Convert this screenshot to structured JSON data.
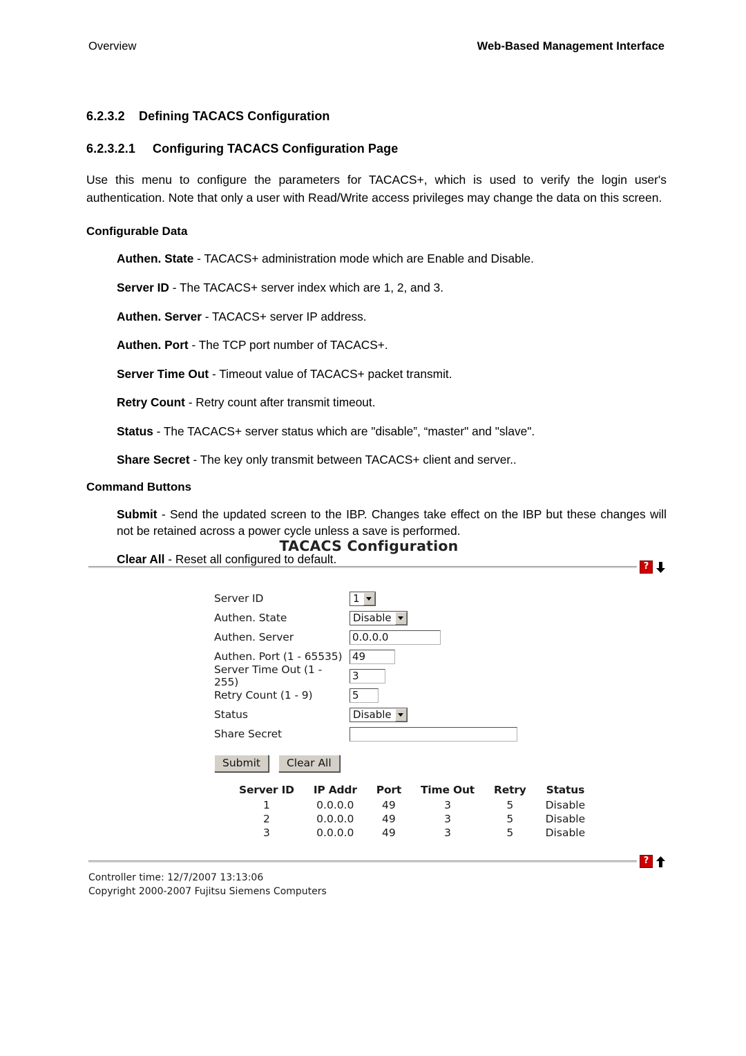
{
  "running_head": {
    "left": "Overview",
    "right": "Web-Based Management Interface"
  },
  "document": {
    "section": {
      "number": "6.2.3.2",
      "title": "Defining TACACS Configuration"
    },
    "subsection": {
      "number": "6.2.3.2.1",
      "title": "Configuring TACACS Configuration Page"
    },
    "intro": "Use this menu to configure the parameters for TACACS+, which is used to verify the login user's authentication. Note that only a user with Read/Write access privileges may change the data on this screen.",
    "configurable_data": {
      "heading": "Configurable Data",
      "items": [
        {
          "term": "Authen. State",
          "desc": " - TACACS+ administration mode which are Enable and Disable."
        },
        {
          "term": "Server ID",
          "desc": " - The TACACS+ server index which are 1, 2, and 3."
        },
        {
          "term": "Authen. Server",
          "desc": " - TACACS+ server IP address."
        },
        {
          "term": "Authen. Port",
          "desc": " - The TCP port number of TACACS+."
        },
        {
          "term": "Server Time Out",
          "desc": " - Timeout value of TACACS+ packet transmit."
        },
        {
          "term": "Retry Count",
          "desc": " - Retry count after transmit timeout."
        },
        {
          "term": "Status",
          "desc": " - The TACACS+ server status which are \"disable”, “master\" and \"slave\"."
        },
        {
          "term": "Share Secret",
          "desc": " - The key only transmit between TACACS+ client and server.."
        }
      ]
    },
    "command_buttons": {
      "heading": "Command Buttons",
      "items": [
        {
          "term": "Submit",
          "desc": " - Send the updated screen to the IBP. Changes take effect on the IBP but these changes will not be retained across a power cycle unless a save is performed."
        },
        {
          "term": "Clear All",
          "desc": " - Reset all configured to default."
        }
      ]
    }
  },
  "screenshot": {
    "title": "TACACS Configuration",
    "help_icon_label": "?",
    "form": {
      "server_id": {
        "label": "Server ID",
        "value": "1",
        "control": "select"
      },
      "authen_state": {
        "label": "Authen. State",
        "value": "Disable",
        "control": "select"
      },
      "authen_server": {
        "label": "Authen. Server",
        "value": "0.0.0.0",
        "control": "text"
      },
      "authen_port": {
        "label": "Authen. Port (1 - 65535)",
        "value": "49",
        "control": "text"
      },
      "server_time_out": {
        "label": "Server Time Out (1 - 255)",
        "value": "3",
        "control": "text"
      },
      "retry_count": {
        "label": "Retry Count (1 - 9)",
        "value": "5",
        "control": "text"
      },
      "status": {
        "label": "Status",
        "value": "Disable",
        "control": "select"
      },
      "share_secret": {
        "label": "Share Secret",
        "value": "",
        "control": "text"
      }
    },
    "buttons": {
      "submit": "Submit",
      "clear_all": "Clear All"
    },
    "table": {
      "columns": [
        "Server ID",
        "IP Addr",
        "Port",
        "Time Out",
        "Retry",
        "Status"
      ],
      "rows": [
        [
          "1",
          "0.0.0.0",
          "49",
          "3",
          "5",
          "Disable"
        ],
        [
          "2",
          "0.0.0.0",
          "49",
          "3",
          "5",
          "Disable"
        ],
        [
          "3",
          "0.0.0.0",
          "49",
          "3",
          "5",
          "Disable"
        ]
      ]
    },
    "footer": {
      "controller_time": "Controller time: 12/7/2007 13:13:06",
      "copyright": "Copyright 2000-2007 Fujitsu Siemens Computers"
    },
    "colors": {
      "help_icon_bg": "#cc0000",
      "rule": "#9b9b9b",
      "button_face": "#d4d0c8"
    }
  }
}
